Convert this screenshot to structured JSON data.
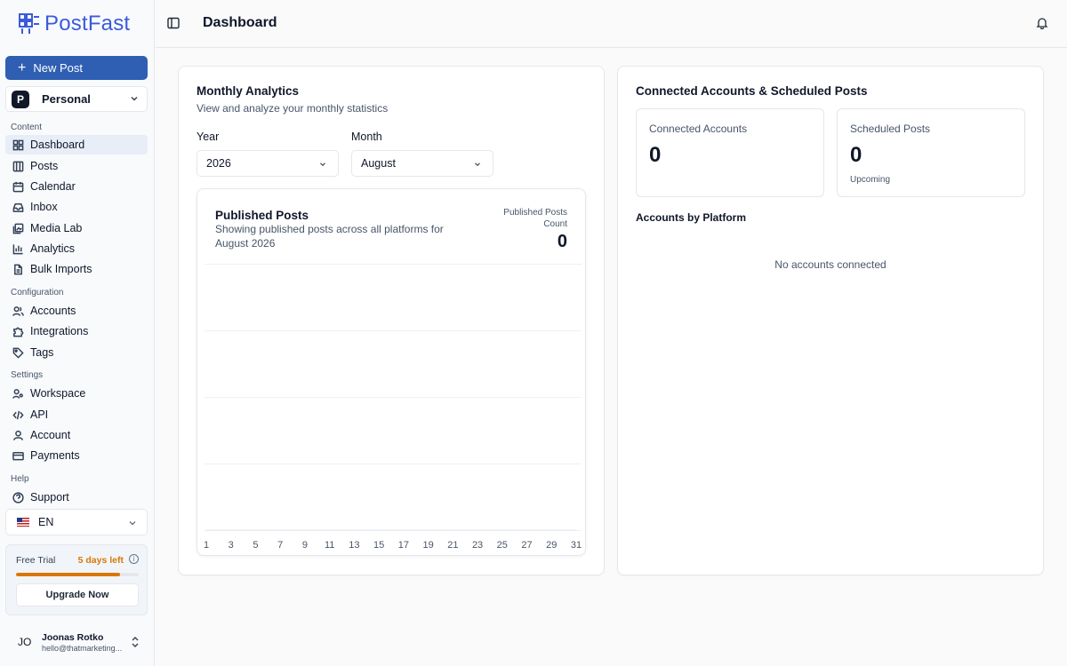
{
  "brand": {
    "name": "PostFast",
    "color": "#3b5bdb",
    "accent": "#2f5fb3"
  },
  "sidebar": {
    "new_post_label": "New Post",
    "workspace": {
      "badge": "P",
      "name": "Personal"
    },
    "sections": {
      "content": "Content",
      "configuration": "Configuration",
      "settings": "Settings",
      "help": "Help"
    },
    "items": {
      "dashboard": {
        "label": "Dashboard",
        "icon": "grid-icon"
      },
      "posts": {
        "label": "Posts",
        "icon": "columns-icon"
      },
      "calendar": {
        "label": "Calendar",
        "icon": "calendar-icon"
      },
      "inbox": {
        "label": "Inbox",
        "icon": "inbox-icon"
      },
      "media_lab": {
        "label": "Media Lab",
        "icon": "images-icon"
      },
      "analytics": {
        "label": "Analytics",
        "icon": "bar-chart-icon"
      },
      "bulk_imports": {
        "label": "Bulk Imports",
        "icon": "file-icon"
      },
      "accounts": {
        "label": "Accounts",
        "icon": "users-icon"
      },
      "integrations": {
        "label": "Integrations",
        "icon": "puzzle-icon"
      },
      "tags": {
        "label": "Tags",
        "icon": "tag-icon"
      },
      "workspace": {
        "label": "Workspace",
        "icon": "workspace-icon"
      },
      "api": {
        "label": "API",
        "icon": "code-icon"
      },
      "account": {
        "label": "Account",
        "icon": "user-icon"
      },
      "payments": {
        "label": "Payments",
        "icon": "credit-card-icon"
      },
      "support": {
        "label": "Support",
        "icon": "help-circle-icon"
      }
    },
    "language": "EN",
    "trial": {
      "label": "Free Trial",
      "days_left": "5 days left",
      "progress": 0.85,
      "color": "#d97706",
      "upgrade_label": "Upgrade Now"
    },
    "user": {
      "initials": "JO",
      "name": "Joonas Rotko",
      "email": "hello@thatmarketing..."
    }
  },
  "header": {
    "title": "Dashboard"
  },
  "analytics": {
    "title": "Monthly Analytics",
    "subtitle": "View and analyze your monthly statistics",
    "year_label": "Year",
    "year_value": "2026",
    "month_label": "Month",
    "month_value": "August",
    "chart": {
      "title": "Published Posts",
      "description": "Showing published posts across all platforms for August 2026",
      "count_label": "Published Posts Count",
      "count_value": "0"
    }
  },
  "accounts": {
    "title": "Connected Accounts & Scheduled Posts",
    "connected_label": "Connected Accounts",
    "connected_value": "0",
    "scheduled_label": "Scheduled Posts",
    "scheduled_value": "0",
    "scheduled_note": "Upcoming",
    "platform_label": "Accounts by Platform",
    "empty_text": "No accounts connected"
  },
  "chart_data": {
    "type": "area",
    "x": [
      1,
      3,
      5,
      7,
      9,
      11,
      13,
      15,
      17,
      19,
      21,
      23,
      25,
      27,
      29,
      31
    ],
    "series": [
      {
        "values": [
          0,
          0,
          0,
          0,
          0,
          0,
          0,
          0,
          0,
          0,
          0,
          0,
          0,
          0,
          0,
          0
        ]
      }
    ],
    "grid": true
  }
}
